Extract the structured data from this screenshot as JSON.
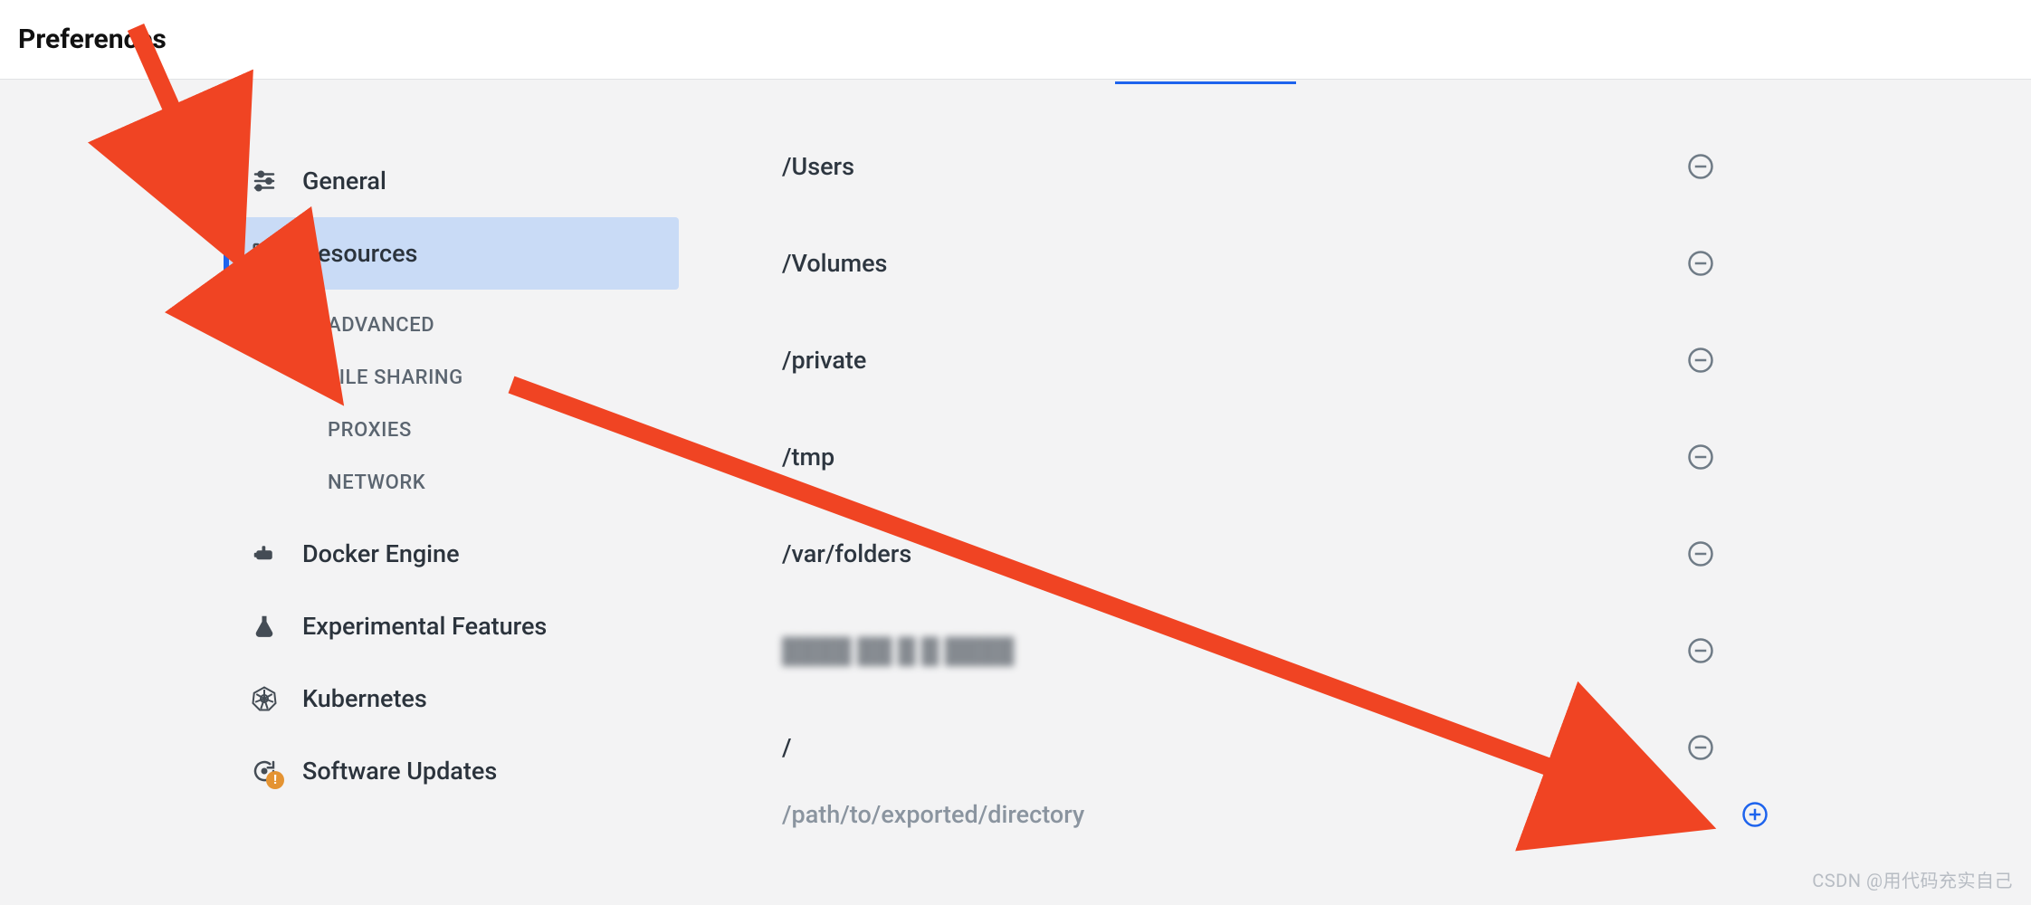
{
  "window": {
    "title": "Preferences"
  },
  "sidebar": {
    "items": [
      {
        "id": "general",
        "label": "General"
      },
      {
        "id": "resources",
        "label": "Resources",
        "selected": true,
        "children": [
          {
            "id": "advanced",
            "label": "ADVANCED"
          },
          {
            "id": "file-sharing",
            "label": "FILE SHARING",
            "active": true
          },
          {
            "id": "proxies",
            "label": "PROXIES"
          },
          {
            "id": "network",
            "label": "NETWORK"
          }
        ]
      },
      {
        "id": "docker-engine",
        "label": "Docker Engine"
      },
      {
        "id": "experimental",
        "label": "Experimental Features"
      },
      {
        "id": "kubernetes",
        "label": "Kubernetes"
      },
      {
        "id": "updates",
        "label": "Software Updates",
        "alert": true
      }
    ]
  },
  "file_sharing": {
    "paths": [
      {
        "path": "/Users"
      },
      {
        "path": "/Volumes"
      },
      {
        "path": "/private"
      },
      {
        "path": "/tmp"
      },
      {
        "path": "/var/folders"
      },
      {
        "path": "████ ██ █ █ ████",
        "blurred": true
      },
      {
        "path": "/"
      }
    ],
    "add_placeholder": "/path/to/exported/directory"
  },
  "watermark": "CSDN @用代码充实自己",
  "colors": {
    "accent": "#1d63ed",
    "arrow": "#f04423",
    "selected_bg": "#c9dbf6"
  }
}
